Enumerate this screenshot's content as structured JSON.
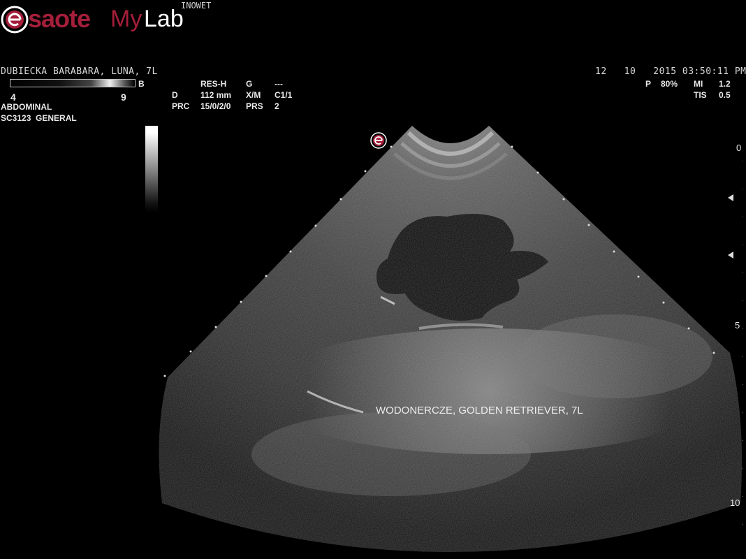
{
  "header": {
    "brand": "saote",
    "brand_e": "e",
    "brand_my": "My",
    "brand_lab": "Lab",
    "site": "INOWET",
    "brand_color": "#a41e3a"
  },
  "patient": {
    "name": "DUBIECKA BARABARA, LUNA, 7L",
    "date": "12   10   2015 03:50:11 PM"
  },
  "gain_scale": {
    "min": "4",
    "max": "9"
  },
  "exam": {
    "preset": "ABDOMINAL",
    "probe": "SC3123  GENERAL"
  },
  "mode": "B",
  "params": {
    "row1": {
      "a": "RES-H",
      "b": "G",
      "c": "---"
    },
    "row2": {
      "k1": "D",
      "v1": "112 mm",
      "k2": "X/M",
      "v2": "C1/1"
    },
    "row3": {
      "k1": "PRC",
      "v1": "15/0/2/0",
      "k2": "PRS",
      "v2": "2"
    }
  },
  "power": {
    "p_label": "P",
    "p_value": "80%",
    "mi_label": "MI",
    "mi_value": "1.2",
    "tis_label": "TIS",
    "tis_value": "0.5"
  },
  "depth_scale": {
    "d0": "0",
    "d5": "5",
    "d10": "10"
  },
  "annotation": "WODONERCZE, GOLDEN RETRIEVER, 7L",
  "icons": {
    "probe_marker": "esaote-e-marker-icon",
    "focus": "focus-triangle-icon"
  }
}
